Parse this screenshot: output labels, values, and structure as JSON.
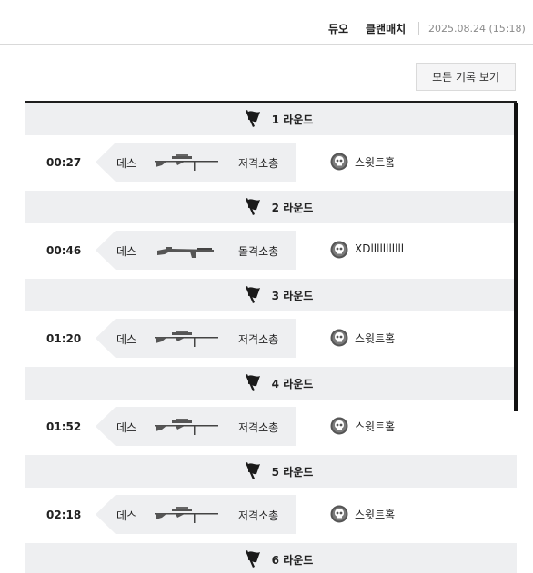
{
  "header": {
    "mode1": "듀오",
    "mode2": "클랜매치",
    "date": "2025.08.24 (15:18)"
  },
  "view_all_label": "모든 기록 보기",
  "rounds": [
    {
      "label": "1 라운드",
      "kill": {
        "time": "00:27",
        "type": "데스",
        "weapon_icon": "sniper-rifle-icon",
        "weapon_type": "저격소총",
        "victim_icon": "skull-icon",
        "victim": "스윗트홈"
      }
    },
    {
      "label": "2 라운드",
      "kill": {
        "time": "00:46",
        "type": "데스",
        "weapon_icon": "assault-rifle-icon",
        "weapon_type": "돌격소총",
        "victim_icon": "skull-icon",
        "victim": "XDlllllllllll"
      }
    },
    {
      "label": "3 라운드",
      "kill": {
        "time": "01:20",
        "type": "데스",
        "weapon_icon": "sniper-rifle-icon",
        "weapon_type": "저격소총",
        "victim_icon": "skull-icon",
        "victim": "스윗트홈"
      }
    },
    {
      "label": "4 라운드",
      "kill": {
        "time": "01:52",
        "type": "데스",
        "weapon_icon": "sniper-rifle-icon",
        "weapon_type": "저격소총",
        "victim_icon": "skull-icon",
        "victim": "스윗트홈"
      }
    },
    {
      "label": "5 라운드",
      "kill": {
        "time": "02:18",
        "type": "데스",
        "weapon_icon": "sniper-rifle-icon",
        "weapon_type": "저격소총",
        "victim_icon": "skull-icon",
        "victim": "스윗트홈"
      }
    },
    {
      "label": "6 라운드"
    }
  ],
  "colors": {
    "round_bg": "#eeeff1",
    "divider": "#1e1e1e",
    "muted_text": "#8a8a8a"
  }
}
